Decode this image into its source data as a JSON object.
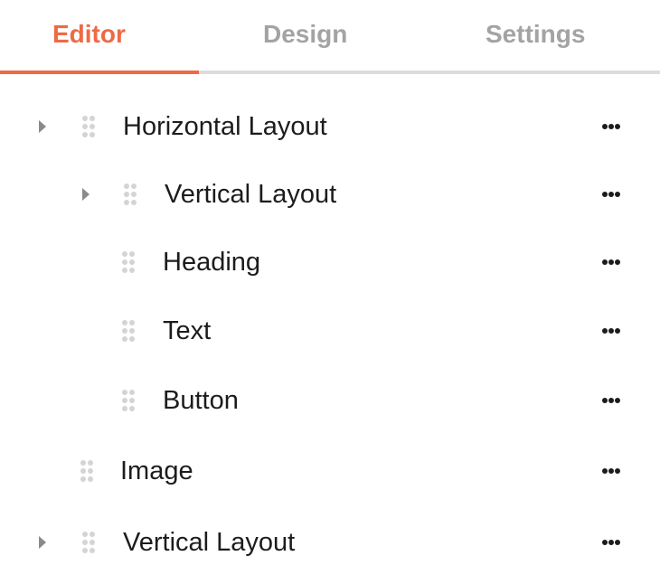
{
  "tabs": [
    {
      "label": "Editor",
      "active": true
    },
    {
      "label": "Design",
      "active": false
    },
    {
      "label": "Settings",
      "active": false
    }
  ],
  "accent_color": "#ee6a45",
  "tree": [
    {
      "label": "Horizontal Layout",
      "expandable": true,
      "depth": 0
    },
    {
      "label": "Vertical Layout",
      "expandable": true,
      "depth": 1
    },
    {
      "label": "Heading",
      "expandable": false,
      "depth": 2
    },
    {
      "label": "Text",
      "expandable": false,
      "depth": 2
    },
    {
      "label": "Button",
      "expandable": false,
      "depth": 2
    },
    {
      "label": "Image",
      "expandable": false,
      "depth": 1
    },
    {
      "label": "Vertical Layout",
      "expandable": true,
      "depth": 0
    }
  ],
  "icons": {
    "caret": "caret-right-icon",
    "drag": "drag-handle-icon",
    "more": "more-icon"
  }
}
